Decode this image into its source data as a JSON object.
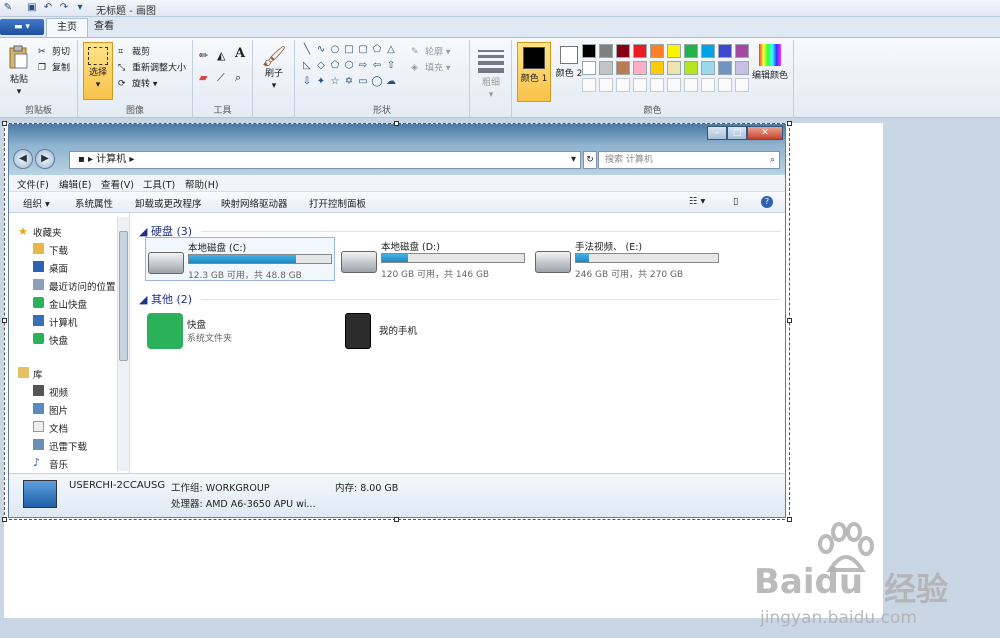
{
  "paint": {
    "title": "无标题 - 画图",
    "tabs": [
      "主页",
      "查看"
    ],
    "clipboard": {
      "paste": "粘贴",
      "cut": "剪切",
      "copy": "复制",
      "group": "剪贴板"
    },
    "image": {
      "select": "选择",
      "crop": "裁剪",
      "resize": "重新调整大小",
      "rotate": "旋转",
      "group": "图像"
    },
    "tools": {
      "group": "工具"
    },
    "brushes": {
      "label": "刷子"
    },
    "shapes": {
      "outline": "轮廓",
      "fill": "填充",
      "group": "形状"
    },
    "size": {
      "label": "粗细"
    },
    "colors": {
      "color1": "颜色 1",
      "color2": "颜色 2",
      "edit": "编辑颜色",
      "group": "颜色",
      "row1": [
        "#000000",
        "#7f7f7f",
        "#880015",
        "#ed1c24",
        "#ff7f27",
        "#fff200",
        "#22b14c",
        "#00a2e8",
        "#3f48cc",
        "#a349a4"
      ],
      "row2": [
        "#ffffff",
        "#c3c3c3",
        "#b97a57",
        "#ffaec9",
        "#ffc90e",
        "#efe4b0",
        "#b5e61d",
        "#99d9ea",
        "#7092be",
        "#c8bfe7"
      ]
    }
  },
  "explorer": {
    "address": "计算机",
    "search_placeholder": "搜索 计算机",
    "menus": [
      "文件(F)",
      "编辑(E)",
      "查看(V)",
      "工具(T)",
      "帮助(H)"
    ],
    "toolbar": [
      "组织 ▾",
      "系统属性",
      "卸载或更改程序",
      "映射网络驱动器",
      "打开控制面板"
    ],
    "nav": {
      "favorites_title": "收藏夹",
      "favorites": [
        "下载",
        "桌面",
        "最近访问的位置",
        "金山快盘",
        "计算机",
        "快盘"
      ],
      "library_title": "库",
      "library": [
        "视频",
        "图片",
        "文档",
        "迅雷下载",
        "音乐"
      ]
    },
    "hard_disks_header": "硬盘 (3)",
    "drives": [
      {
        "name": "本地磁盘 (C:)",
        "detail": "12.3 GB 可用，共 48.8 GB",
        "used_fraction": 0.75
      },
      {
        "name": "本地磁盘 (D:)",
        "detail": "120 GB 可用，共 146 GB",
        "used_fraction": 0.18
      },
      {
        "name": "手法视频、 (E:)",
        "detail": "246 GB 可用，共 270 GB",
        "used_fraction": 0.09
      }
    ],
    "other_header": "其他 (2)",
    "other": [
      {
        "name": "快盘",
        "detail": "系统文件夹"
      },
      {
        "name": "我的手机",
        "detail": ""
      }
    ],
    "details": {
      "computer": "USERCHI-2CCAUSG",
      "workgroup": "工作组: WORKGROUP",
      "memory": "内存: 8.00 GB",
      "processor": "处理器: AMD A6-3650 APU wi..."
    }
  },
  "watermark": {
    "brand": "Baidu",
    "cn": "经验",
    "url": "jingyan.baidu.com"
  }
}
